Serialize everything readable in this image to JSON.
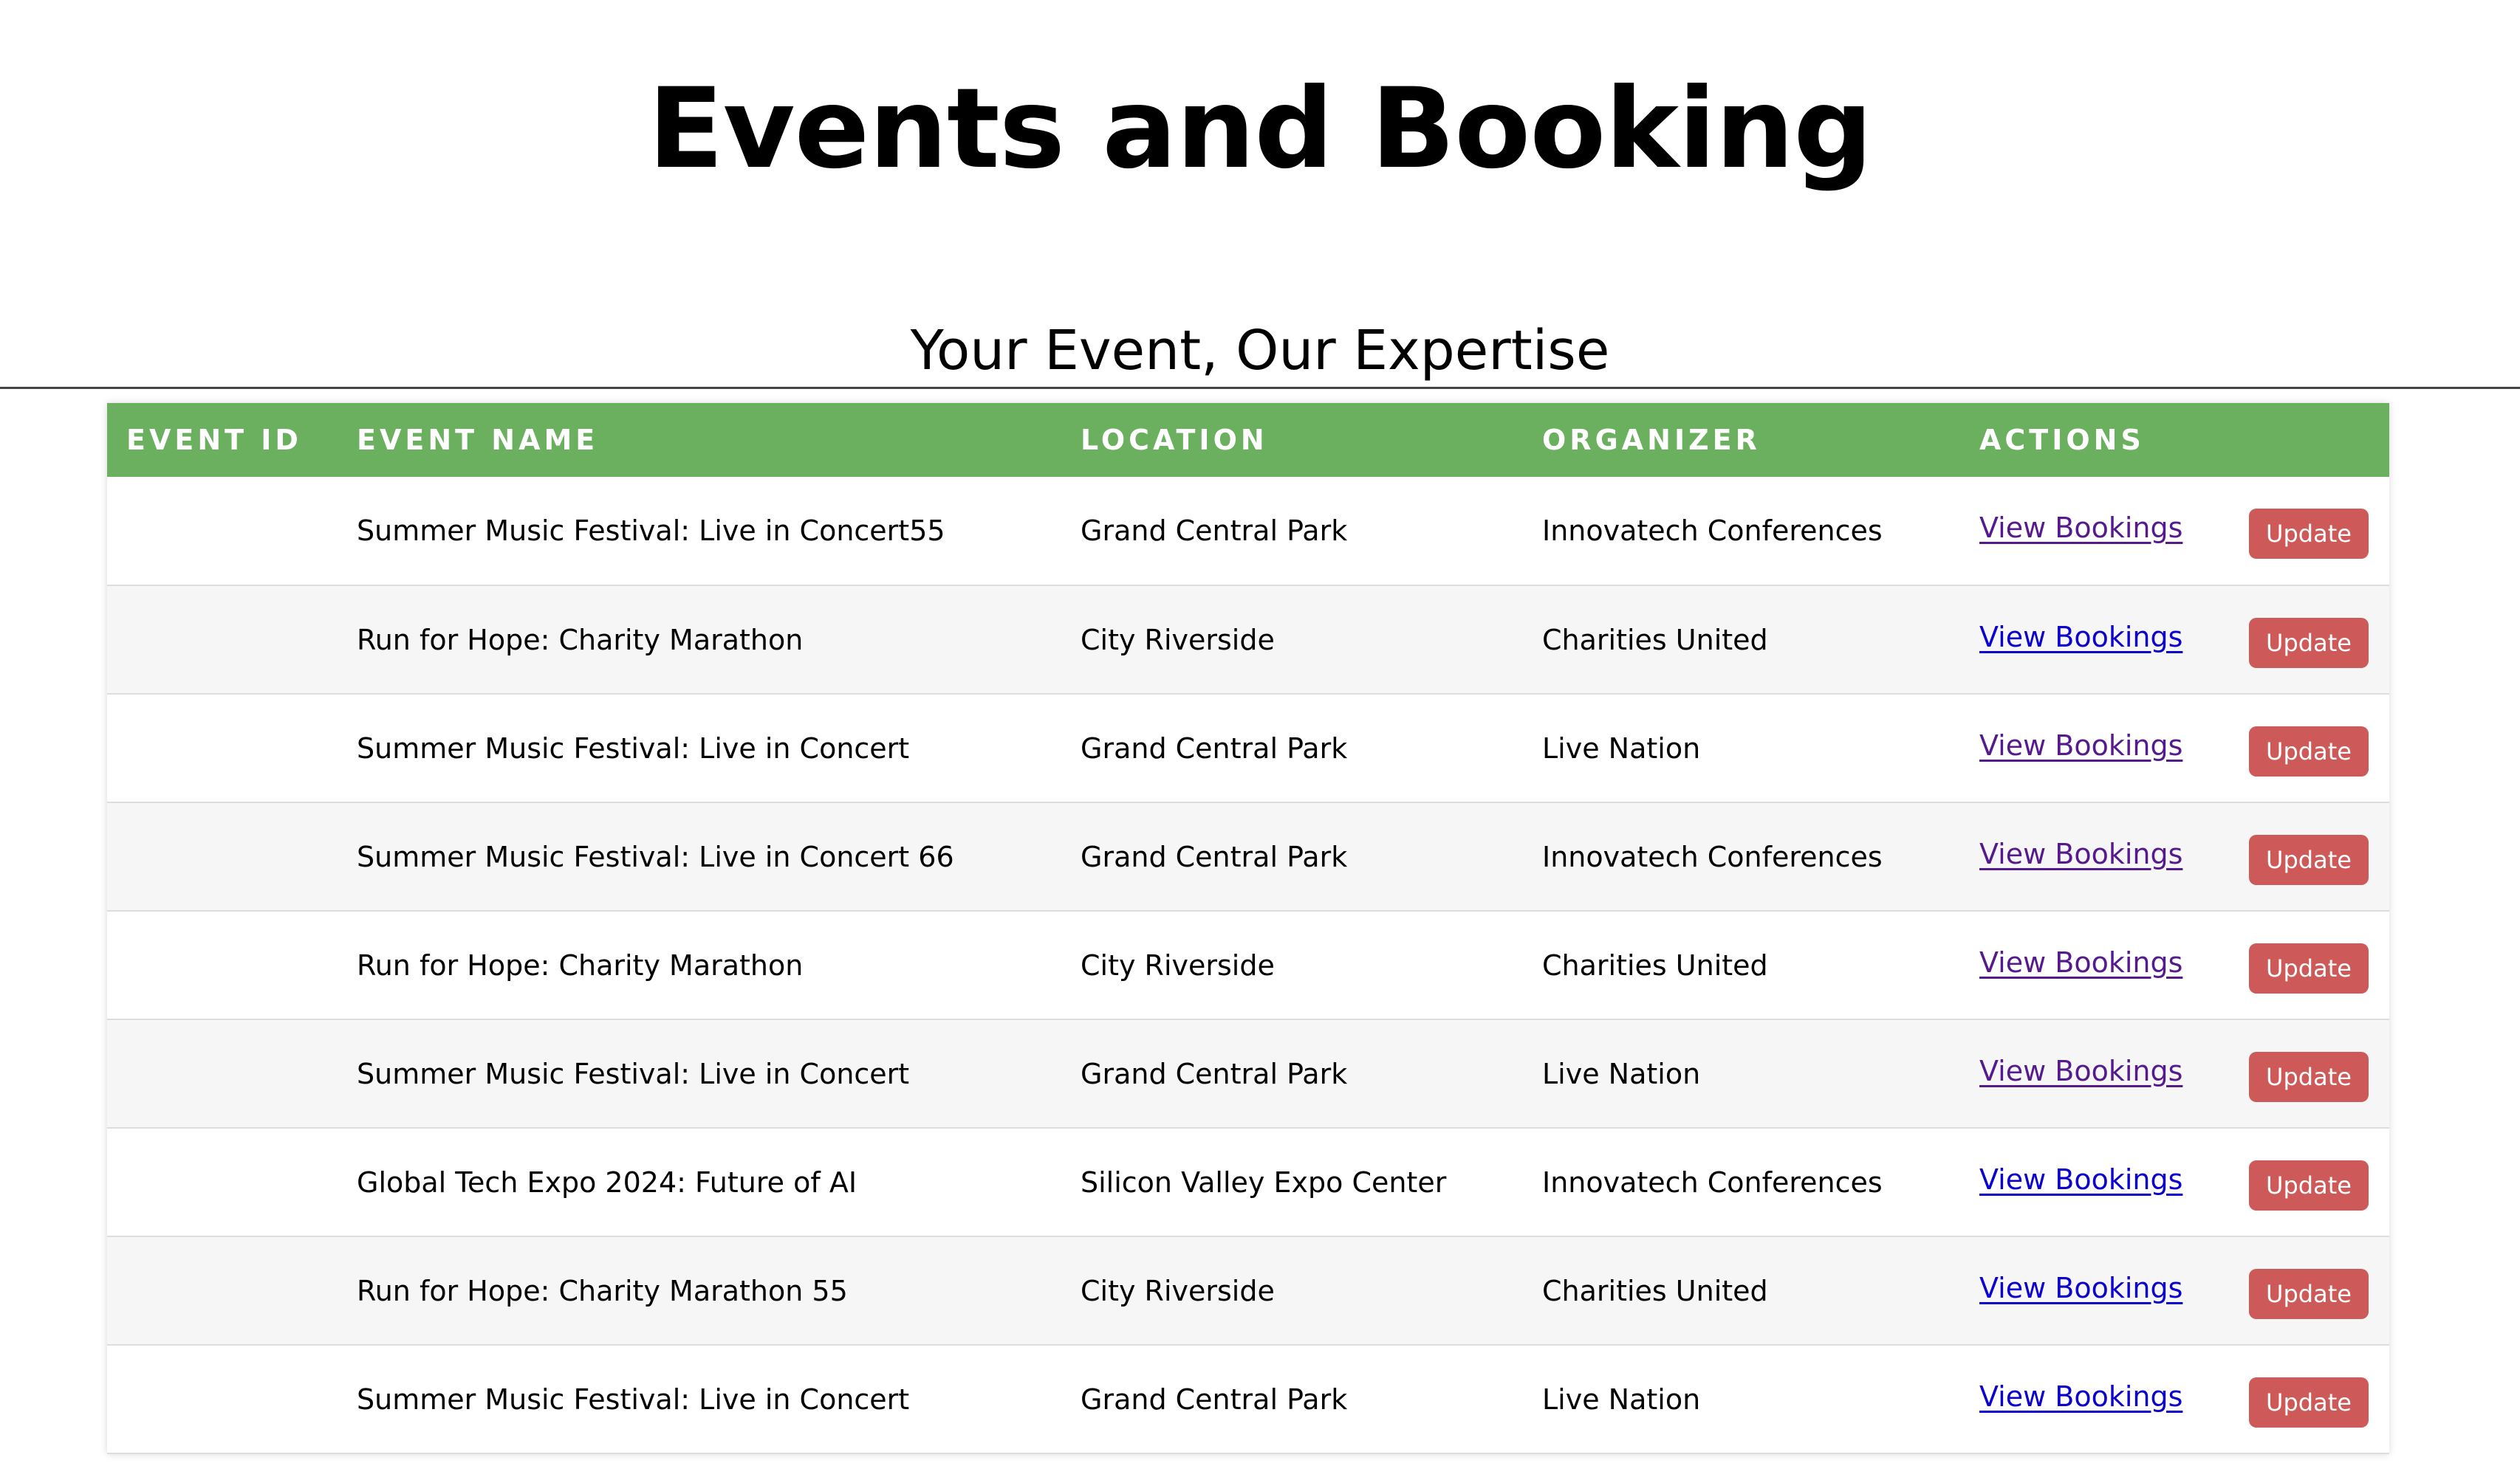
{
  "header": {
    "title": "Events and Booking",
    "subtitle": "Your Event, Our Expertise"
  },
  "table": {
    "columns": [
      "EVENT ID",
      "EVENT NAME",
      "LOCATION",
      "ORGANIZER",
      "ACTIONS"
    ],
    "view_label": "View Bookings",
    "update_label": "Update",
    "rows": [
      {
        "id": "",
        "name": "Summer Music Festival: Live in Concert55",
        "location": "Grand Central Park",
        "organizer": "Innovatech Conferences",
        "visited": true
      },
      {
        "id": "",
        "name": "Run for Hope: Charity Marathon",
        "location": "City Riverside",
        "organizer": "Charities United",
        "visited": false
      },
      {
        "id": "",
        "name": "Summer Music Festival: Live in Concert",
        "location": "Grand Central Park",
        "organizer": "Live Nation",
        "visited": true
      },
      {
        "id": "",
        "name": "Summer Music Festival: Live in Concert 66",
        "location": "Grand Central Park",
        "organizer": "Innovatech Conferences",
        "visited": true
      },
      {
        "id": "",
        "name": "Run for Hope: Charity Marathon",
        "location": "City Riverside",
        "organizer": "Charities United",
        "visited": true
      },
      {
        "id": "",
        "name": "Summer Music Festival: Live in Concert",
        "location": "Grand Central Park",
        "organizer": "Live Nation",
        "visited": true
      },
      {
        "id": "",
        "name": "Global Tech Expo 2024: Future of AI",
        "location": "Silicon Valley Expo Center",
        "organizer": "Innovatech Conferences",
        "visited": false
      },
      {
        "id": "",
        "name": "Run for Hope: Charity Marathon 55",
        "location": "City Riverside",
        "organizer": "Charities United",
        "visited": false
      },
      {
        "id": "",
        "name": "Summer Music Festival: Live in Concert",
        "location": "Grand Central Park",
        "organizer": "Live Nation",
        "visited": false
      }
    ]
  },
  "colors": {
    "header_bg": "#6ab05f",
    "update_bg": "#cd5a58",
    "link": "#0b00cc",
    "link_visited": "#551a8b"
  }
}
